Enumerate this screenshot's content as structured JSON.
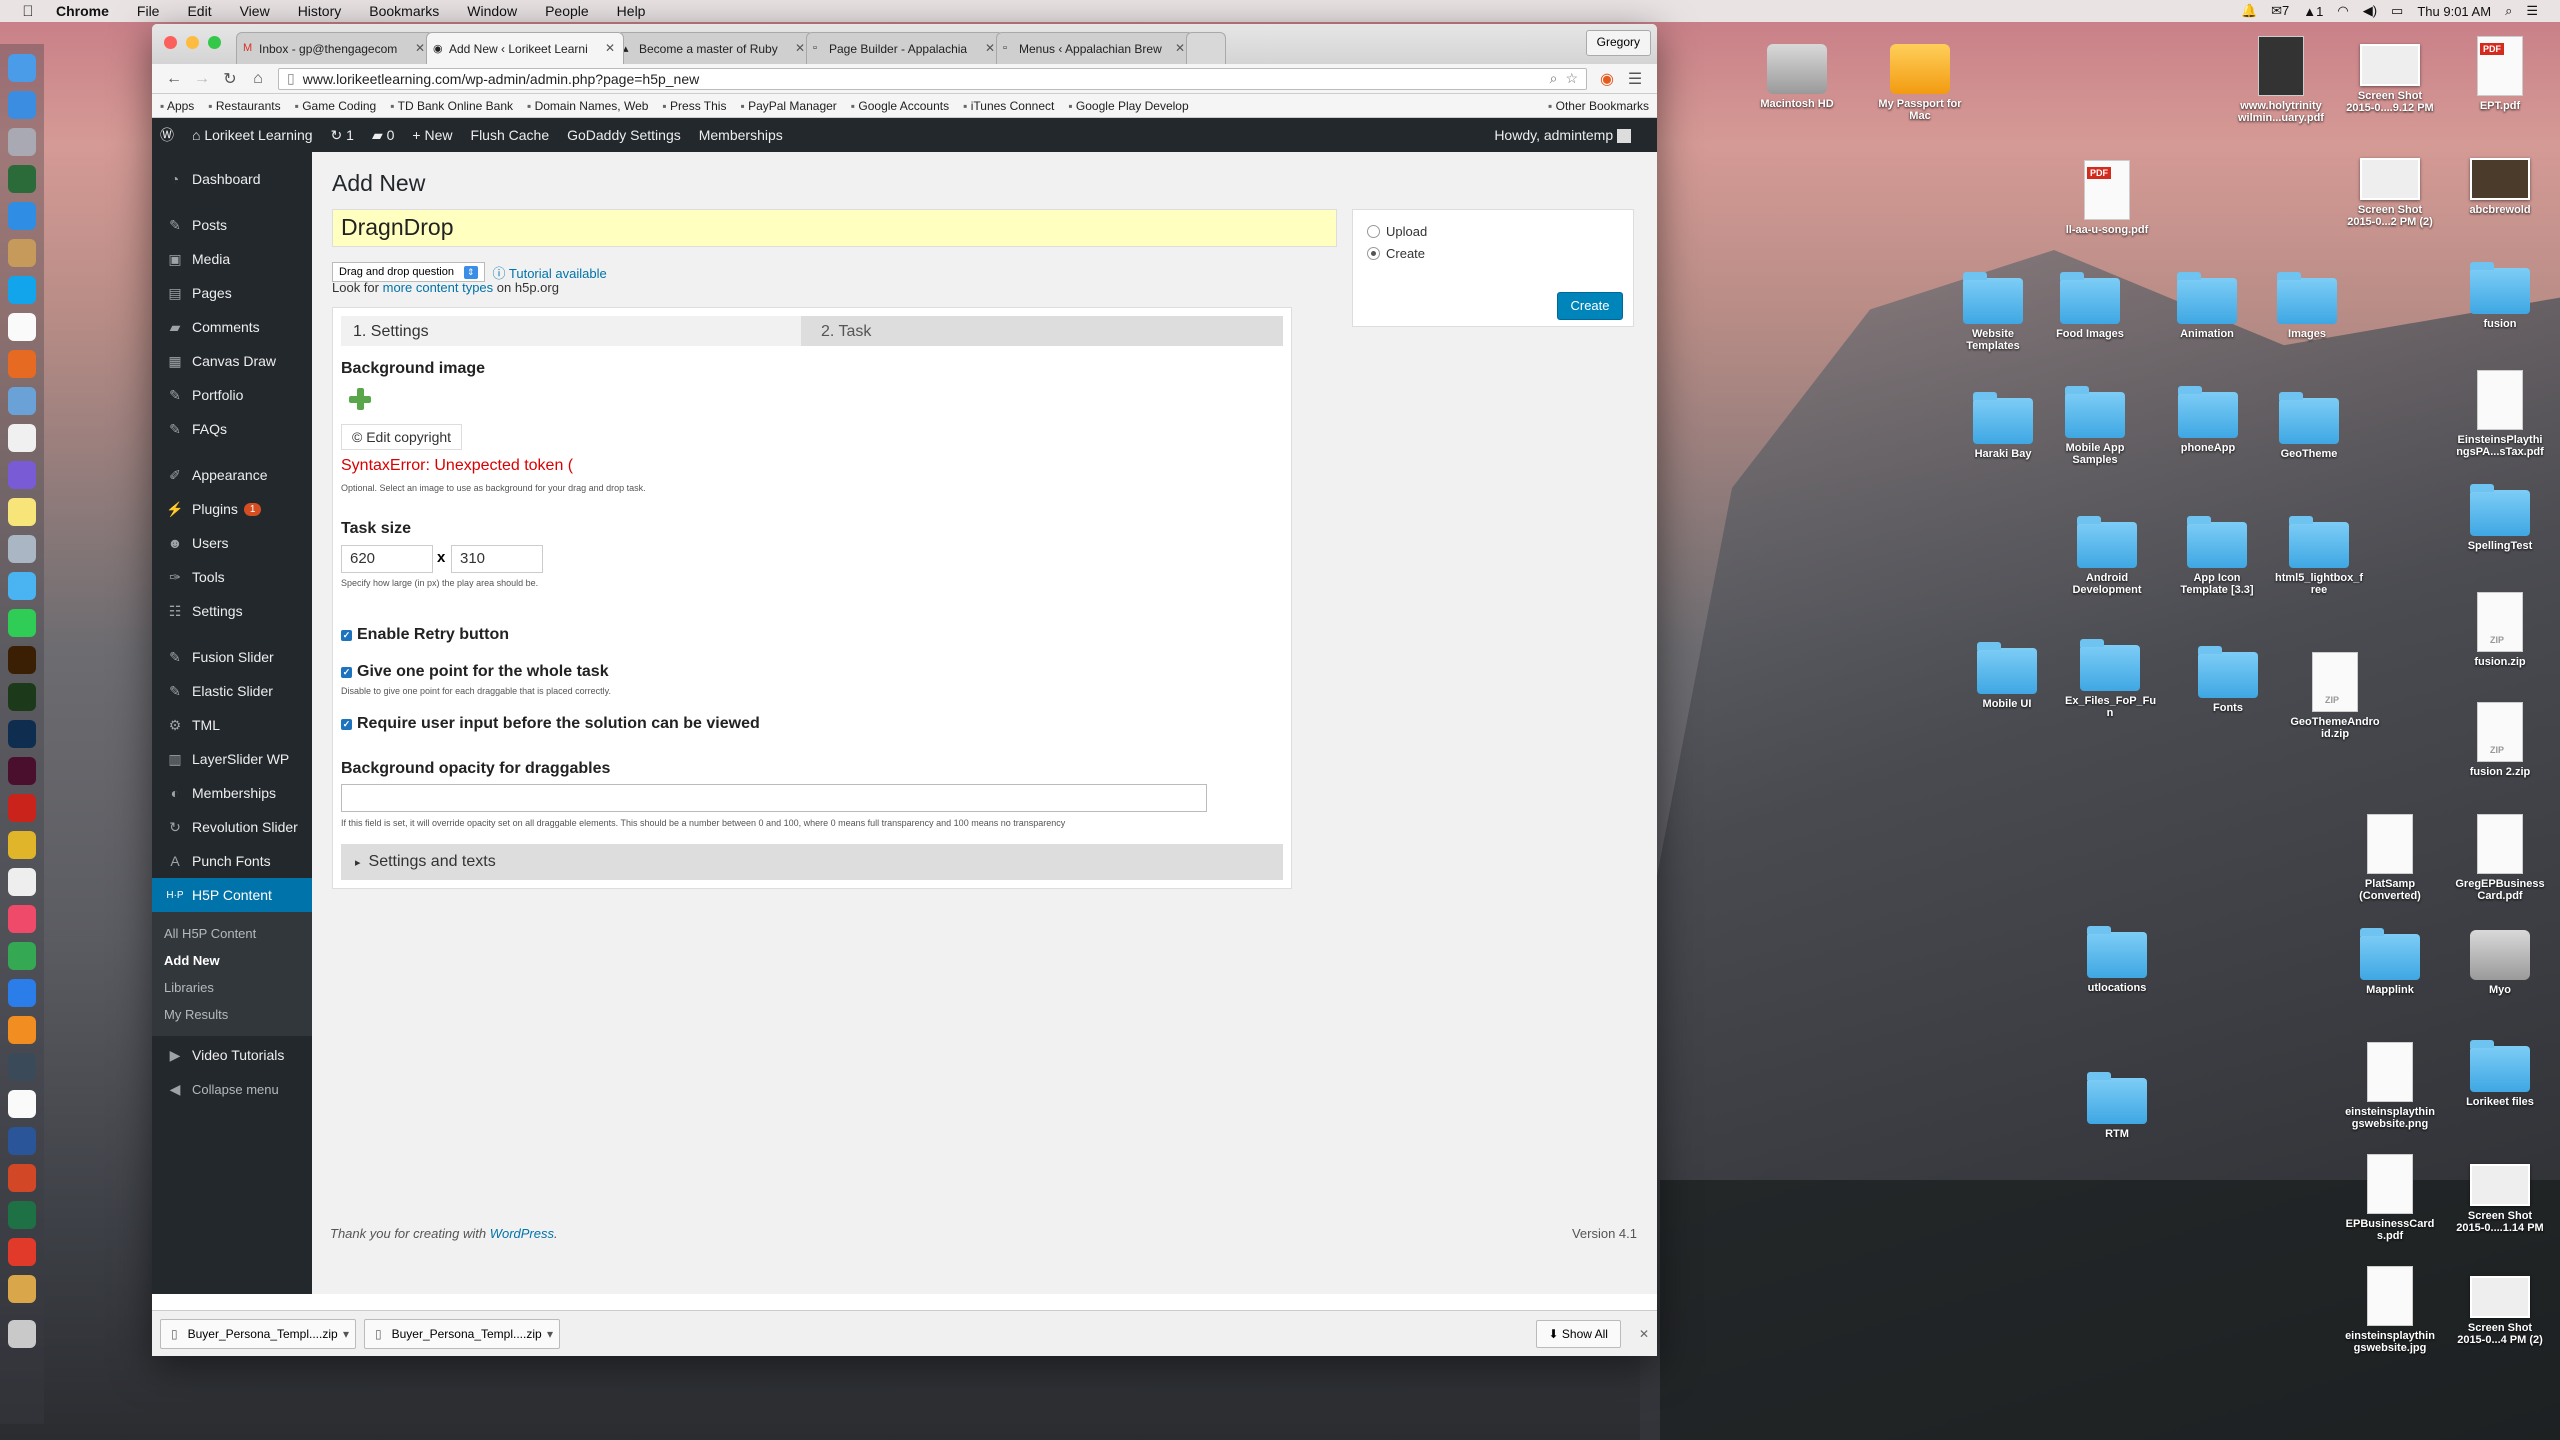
{
  "menubar": {
    "app": "Chrome",
    "items": [
      "File",
      "Edit",
      "View",
      "History",
      "Bookmarks",
      "Window",
      "People",
      "Help"
    ],
    "mail_count": "7",
    "status_num": "1",
    "clock": "Thu 9:01 AM"
  },
  "browser": {
    "tabs": [
      {
        "label": "Inbox - gp@thengagecom"
      },
      {
        "label": "Add New ‹ Lorikeet Learni"
      },
      {
        "label": "Become a master of Ruby"
      },
      {
        "label": "Page Builder - Appalachia"
      },
      {
        "label": "Menus ‹ Appalachian Brew"
      }
    ],
    "profile": "Gregory",
    "url": "www.lorikeetlearning.com/wp-admin/admin.php?page=h5p_new",
    "bookmarks": [
      "Apps",
      "Restaurants",
      "Game Coding",
      "TD Bank Online Bank",
      "Domain Names, Web",
      "Press This",
      "PayPal Manager",
      "Google Accounts",
      "iTunes Connect",
      "Google Play Develop"
    ],
    "other_bookmarks": "Other Bookmarks"
  },
  "adminbar": {
    "site": "Lorikeet Learning",
    "updates": "1",
    "comments": "0",
    "new": "New",
    "flush": "Flush Cache",
    "godaddy": "GoDaddy Settings",
    "memberships": "Memberships",
    "howdy": "Howdy, admintemp"
  },
  "sidebar": {
    "dashboard": "Dashboard",
    "posts": "Posts",
    "media": "Media",
    "pages": "Pages",
    "comments": "Comments",
    "canvas_draw": "Canvas Draw",
    "portfolio": "Portfolio",
    "faqs": "FAQs",
    "appearance": "Appearance",
    "plugins": "Plugins",
    "plugins_badge": "1",
    "users": "Users",
    "tools": "Tools",
    "settings": "Settings",
    "fusion_slider": "Fusion Slider",
    "elastic_slider": "Elastic Slider",
    "tml": "TML",
    "layerslider": "LayerSlider WP",
    "memberships": "Memberships",
    "revolution": "Revolution Slider",
    "punch_fonts": "Punch Fonts",
    "h5p": "H5P Content",
    "sub_all": "All H5P Content",
    "sub_add": "Add New",
    "sub_libraries": "Libraries",
    "sub_results": "My Results",
    "video_tutorials": "Video Tutorials",
    "collapse": "Collapse menu"
  },
  "main": {
    "page_title": "Add New",
    "title_value": "DragnDrop",
    "content_type": "Drag and drop question",
    "tutorial": "Tutorial available",
    "look_for_pre": "Look for",
    "look_for_link": "more content types",
    "look_for_post": "on h5p.org",
    "step1": "1. Settings",
    "step2": "2. Task",
    "bg_label": "Background image",
    "edit_copyright": "Edit copyright",
    "error": "SyntaxError: Unexpected token (",
    "bg_desc": "Optional. Select an image to use as background for your drag and drop task.",
    "task_size_label": "Task size",
    "width": "620",
    "height": "310",
    "x_sep": "x",
    "size_desc": "Specify how large (in px) the play area should be.",
    "retry": "Enable Retry button",
    "one_point": "Give one point for the whole task",
    "one_point_desc": "Disable to give one point for each draggable that is placed correctly.",
    "require_input": "Require user input before the solution can be viewed",
    "opacity_label": "Background opacity for draggables",
    "opacity_desc": "If this field is set, it will override opacity set on all draggable elements. This should be a number between 0 and 100, where 0 means full transparency and 100 means no transparency",
    "settings_texts": "Settings and texts",
    "upload": "Upload",
    "create_radio": "Create",
    "create_btn": "Create"
  },
  "footer": {
    "thanks": "Thank you for creating with",
    "wp": "WordPress",
    "version": "Version 4.1"
  },
  "downloads": {
    "items": [
      "Buyer_Persona_Templ....zip",
      "Buyer_Persona_Templ....zip"
    ],
    "show_all": "Show All"
  },
  "desktop": {
    "icons": {
      "macintosh": "Macintosh HD",
      "passport": "My Passport for Mac",
      "holytrinity": "www.holytrinity wilmin...uary.pdf",
      "shot1": "Screen Shot 2015-0....9.12 PM",
      "ept": "EPT.pdf",
      "song": "ll-aa-u-song.pdf",
      "shot2": "Screen Shot 2015-0...2 PM (2)",
      "abcbrewold": "abcbrewold",
      "website_templates": "Website Templates",
      "food_images": "Food Images",
      "animation": "Animation",
      "images": "Images",
      "fusion": "fusion",
      "haraki": "Haraki Bay",
      "mobile_app": "Mobile App Samples",
      "phoneapp": "phoneApp",
      "geotheme": "GeoTheme",
      "einstein_pdf": "EinsteinsPlaythi ngsPA...sTax.pdf",
      "android": "Android Development",
      "appicon": "App Icon Template [3.3]",
      "lightbox": "html5_lightbox_f ree",
      "spelling": "SpellingTest",
      "fusionzip": "fusion.zip",
      "mobileui": "Mobile UI",
      "exfiles": "Ex_Files_FoP_Fu n",
      "fonts": "Fonts",
      "geozip": "GeoThemeAndro id.zip",
      "fusion2": "fusion 2.zip",
      "platsamp": "PlatSamp (Converted)",
      "greg_card": "GregEPBusiness Card.pdf",
      "utlocations": "utlocations",
      "mapplink": "Mapplink",
      "myo": "Myo",
      "einstein_png": "einsteinsplaythin gswebsite.png",
      "lorikeet": "Lorikeet files",
      "rtm": "RTM",
      "ep_cards": "EPBusinessCard s.pdf",
      "shot3": "Screen Shot 2015-0....1.14 PM",
      "einstein_jpg": "einsteinsplaythin gswebsite.jpg",
      "shot4": "Screen Shot 2015-0...4 PM (2)"
    }
  },
  "colors": {
    "wp_admin_dark": "#23282d",
    "wp_blue": "#0073aa",
    "error_red": "#da0001",
    "title_highlight": "#ffffc0"
  }
}
